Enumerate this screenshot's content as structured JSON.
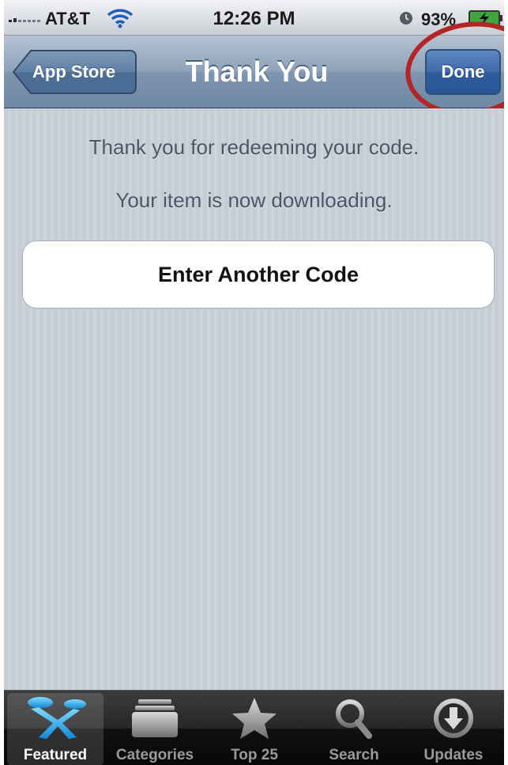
{
  "status_bar": {
    "carrier": "AT&T",
    "time": "12:26 PM",
    "battery": "93%"
  },
  "nav": {
    "back_label": "App Store",
    "title": "Thank You",
    "done_label": "Done"
  },
  "content": {
    "message_1": "Thank you for redeeming your code.",
    "message_2": "Your item is now downloading.",
    "button_label": "Enter Another Code"
  },
  "tabs": [
    {
      "label": "Featured",
      "icon": "featured-icon",
      "selected": true
    },
    {
      "label": "Categories",
      "icon": "categories-icon",
      "selected": false
    },
    {
      "label": "Top 25",
      "icon": "star-icon",
      "selected": false
    },
    {
      "label": "Search",
      "icon": "search-icon",
      "selected": false
    },
    {
      "label": "Updates",
      "icon": "updates-icon",
      "selected": false
    }
  ],
  "colors": {
    "highlight": "#b42525",
    "nav_bar": "#8da2b9",
    "done_button": "#3e6aa8"
  }
}
